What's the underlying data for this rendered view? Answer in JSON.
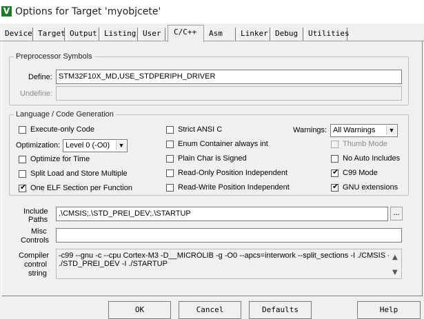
{
  "window": {
    "title": "Options for Target 'myobjcete'",
    "app_icon_letter": "V"
  },
  "tabs": [
    "Device",
    "Target",
    "Output",
    "Listing",
    "User",
    "C/C++",
    "Asm",
    "Linker",
    "Debug",
    "Utilities"
  ],
  "active_tab": "C/C++",
  "preprocessor": {
    "legend": "Preprocessor Symbols",
    "define_label": "Define:",
    "define_value": "STM32F10X_MD,USE_STDPERIPH_DRIVER",
    "undefine_label": "Undefine:",
    "undefine_value": ""
  },
  "language": {
    "legend": "Language / Code Generation",
    "execute_only": {
      "label": "Execute-only Code",
      "checked": false
    },
    "optimization_label": "Optimization:",
    "optimization_value": "Level 0 (-O0)",
    "optimize_time": {
      "label": "Optimize for Time",
      "checked": false
    },
    "split_load": {
      "label": "Split Load and Store Multiple",
      "checked": false
    },
    "one_elf": {
      "label": "One ELF Section per Function",
      "checked": true
    },
    "strict_ansi": {
      "label": "Strict ANSI C",
      "checked": false
    },
    "enum_container": {
      "label": "Enum Container always int",
      "checked": false
    },
    "plain_char": {
      "label": "Plain Char is Signed",
      "checked": false
    },
    "ro_pi": {
      "label": "Read-Only Position Independent",
      "checked": false
    },
    "rw_pi": {
      "label": "Read-Write Position Independent",
      "checked": false
    },
    "warnings_label": "Warnings:",
    "warnings_value": "All Warnings",
    "thumb_mode": {
      "label": "Thumb Mode",
      "checked": false,
      "enabled": false
    },
    "no_auto_includes": {
      "label": "No Auto Includes",
      "checked": false
    },
    "c99_mode": {
      "label": "C99 Mode",
      "checked": true
    },
    "gnu_extensions": {
      "label": "GNU extensions",
      "checked": true
    }
  },
  "include_paths": {
    "label_line1": "Include",
    "label_line2": "Paths",
    "value": ".\\CMSIS;.\\STD_PREI_DEV;.\\STARTUP",
    "browse_label": "..."
  },
  "misc_controls": {
    "label_line1": "Misc",
    "label_line2": "Controls",
    "value": ""
  },
  "compiler_string": {
    "label_line1": "Compiler",
    "label_line2": "control",
    "label_line3": "string",
    "line1": "-c99 --gnu -c --cpu Cortex-M3 -D__MICROLIB -g -O0 --apcs=interwork --split_sections -I ./CMSIS -I",
    "line2": "./STD_PREI_DEV -I ./STARTUP"
  },
  "buttons": {
    "ok": "OK",
    "cancel": "Cancel",
    "defaults": "Defaults",
    "help": "Help"
  },
  "glyphs": {
    "check": "✔",
    "dropdown": "▼",
    "scroll_up": "▲",
    "scroll_down": "▼"
  },
  "colors": {
    "dialog_bg": "#f0f0f0",
    "app_icon_bg": "#1f7a2e"
  }
}
